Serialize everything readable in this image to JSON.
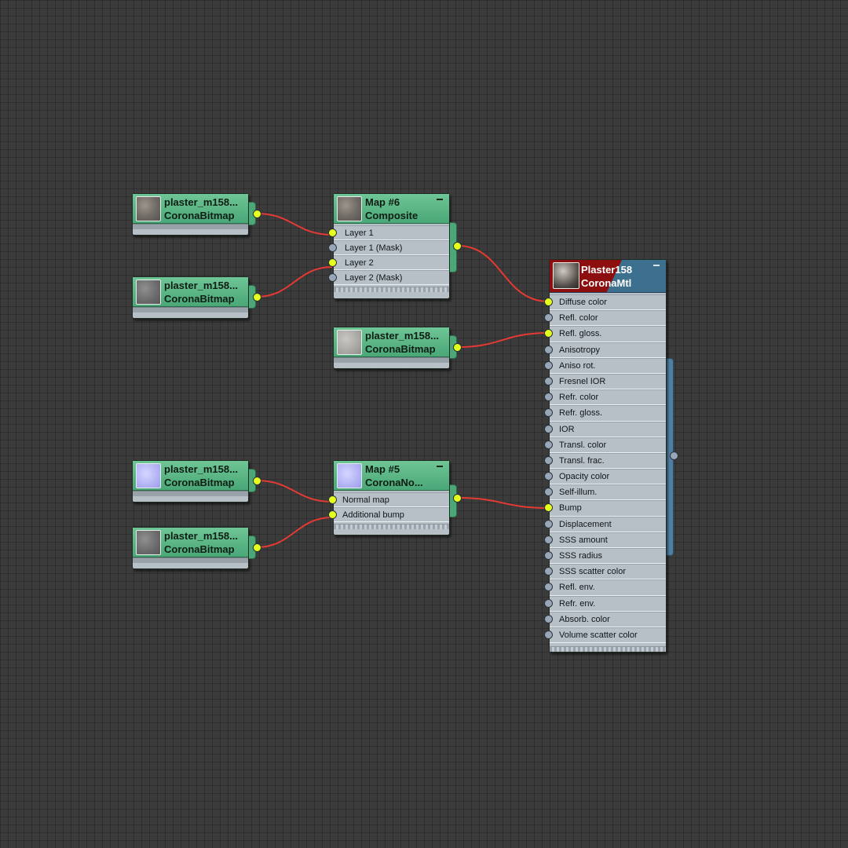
{
  "nodes": {
    "bitmap1": {
      "title": "plaster_m158...",
      "type": "CoronaBitmap"
    },
    "bitmap2": {
      "title": "plaster_m158...",
      "type": "CoronaBitmap"
    },
    "bitmap3": {
      "title": "plaster_m158...",
      "type": "CoronaBitmap"
    },
    "bitmap4": {
      "title": "plaster_m158...",
      "type": "CoronaBitmap"
    },
    "bitmap5": {
      "title": "plaster_m158...",
      "type": "CoronaBitmap"
    },
    "composite": {
      "title": "Map #6",
      "type": "Composite",
      "slots": [
        "Layer 1",
        "Layer 1 (Mask)",
        "Layer 2",
        "Layer 2 (Mask)"
      ]
    },
    "normal": {
      "title": "Map #5",
      "type": "CoronaNo...",
      "slots": [
        "Normal map",
        "Additional bump"
      ]
    },
    "material": {
      "title": "Plaster158",
      "type": "CoronaMtl",
      "slots": [
        "Diffuse color",
        "Refl. color",
        "Refl. gloss.",
        "Anisotropy",
        "Aniso rot.",
        "Fresnel IOR",
        "Refr. color",
        "Refr. gloss.",
        "IOR",
        "Transl. color",
        "Transl. frac.",
        "Opacity color",
        "Self-illum.",
        "Bump",
        "Displacement",
        "SSS amount",
        "SSS radius",
        "SSS scatter color",
        "Refl. env.",
        "Refr. env.",
        "Absorb. color",
        "Volume scatter color"
      ]
    }
  },
  "colors": {
    "background": "#3b3b3b",
    "bitmap_header": "#4aa777",
    "material_header_left": "#8c0e0e",
    "material_header_right": "#3d6f8f",
    "wire": "#e53a33",
    "socket_connected": "#e5ff1e",
    "socket_empty": "#98a7b7"
  }
}
